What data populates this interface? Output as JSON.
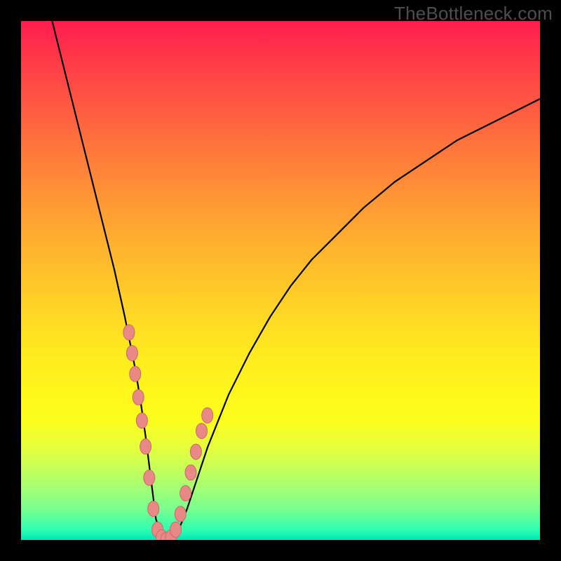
{
  "watermark": "TheBottleneck.com",
  "colors": {
    "curve_stroke": "#000000",
    "marker_fill": "#e98985",
    "marker_stroke": "#c76b66"
  },
  "chart_data": {
    "type": "line",
    "title": "",
    "xlabel": "",
    "ylabel": "",
    "x_range": [
      0,
      100
    ],
    "y_range": [
      0,
      100
    ],
    "series": [
      {
        "name": "bottleneck-curve",
        "x": [
          6,
          8,
          10,
          12,
          14,
          16,
          18,
          20,
          21,
          22,
          23,
          24,
          25,
          26,
          27,
          28,
          29,
          30,
          32,
          34,
          36,
          40,
          44,
          48,
          52,
          56,
          60,
          66,
          72,
          78,
          84,
          90,
          96,
          100
        ],
        "y": [
          100,
          92,
          84,
          76,
          68,
          60,
          52,
          43,
          38,
          33,
          27,
          20,
          12,
          4,
          1,
          0,
          0,
          1,
          6,
          12,
          18,
          28,
          36,
          43,
          49,
          54,
          58,
          64,
          69,
          73,
          77,
          80,
          83,
          85
        ]
      }
    ],
    "markers": {
      "name": "highlighted-points",
      "x": [
        20.8,
        21.4,
        22.0,
        22.6,
        23.3,
        24.0,
        24.7,
        25.5,
        26.3,
        27.1,
        28.0,
        28.9,
        29.8,
        30.7,
        31.7,
        32.7,
        33.7,
        34.8,
        35.9
      ],
      "y": [
        40,
        36,
        32,
        27.5,
        23,
        18,
        12,
        6,
        2,
        0.5,
        0,
        0.5,
        2,
        5,
        9,
        13,
        17,
        21,
        24
      ]
    },
    "gradient_stops": [
      {
        "pos": 0,
        "color": "#ff1d4e"
      },
      {
        "pos": 50,
        "color": "#ffd326"
      },
      {
        "pos": 80,
        "color": "#fcfd1d"
      },
      {
        "pos": 100,
        "color": "#00e6b4"
      }
    ]
  }
}
